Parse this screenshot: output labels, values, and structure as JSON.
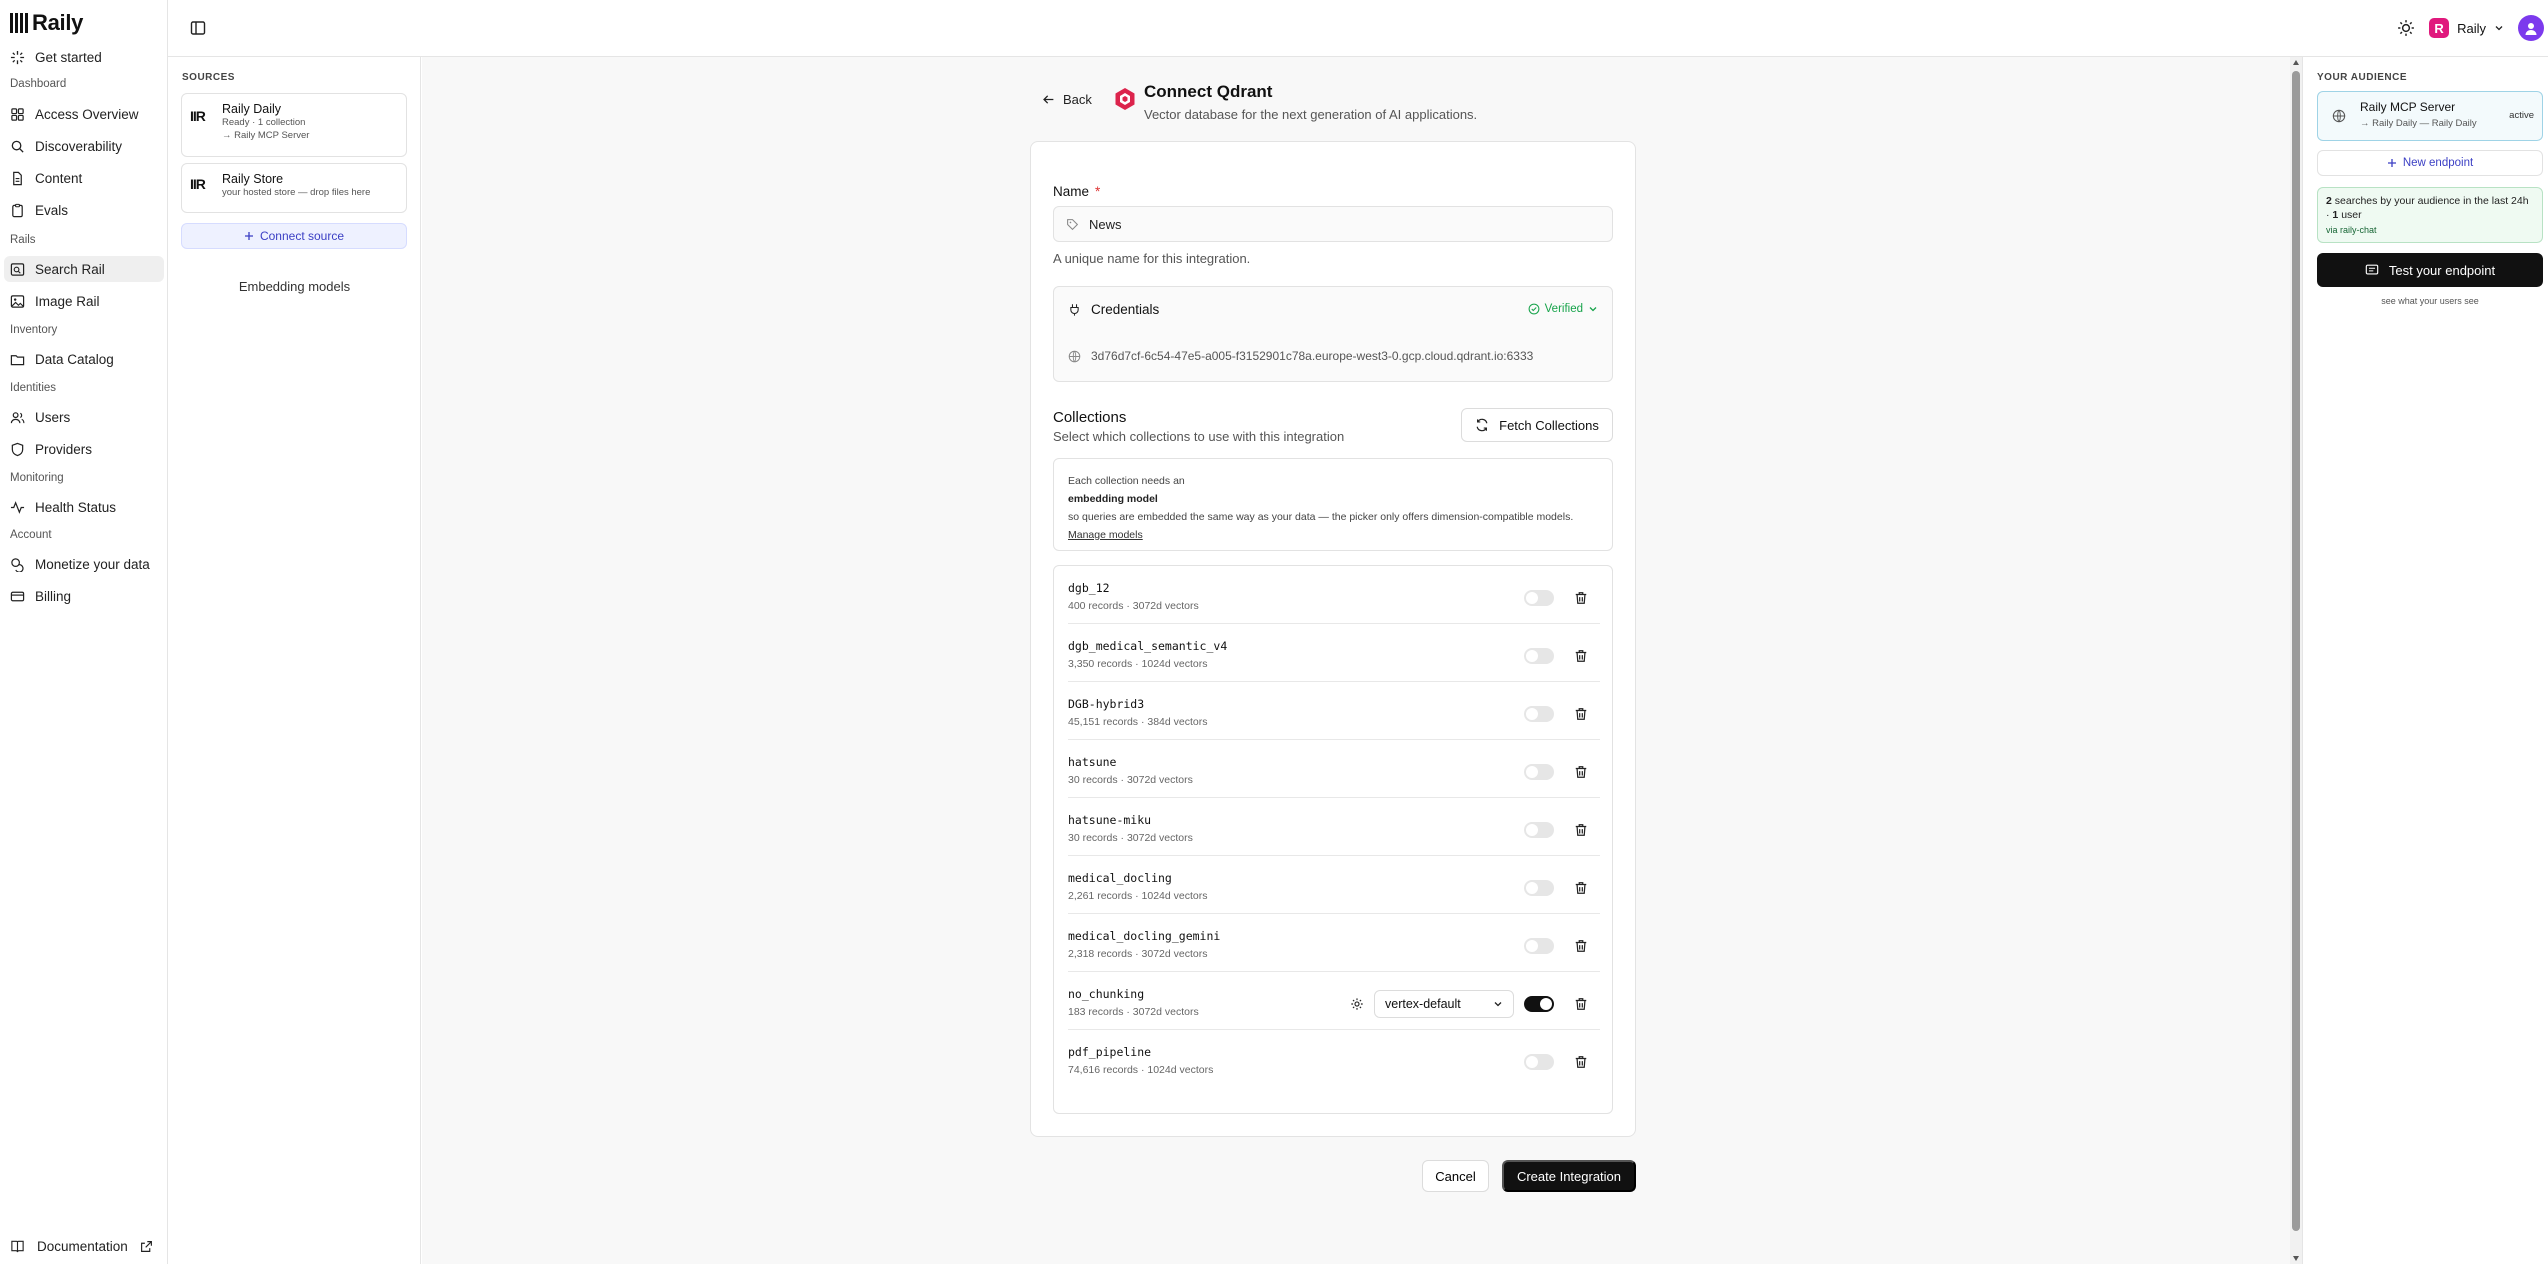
{
  "app": {
    "logo_text": "Raily"
  },
  "nav": {
    "get_started": "Get started",
    "sections": {
      "dashboard": "Dashboard",
      "rails": "Rails",
      "inventory": "Inventory",
      "identities": "Identities",
      "monitoring": "Monitoring",
      "account": "Account"
    },
    "items": {
      "access_overview": "Access Overview",
      "discoverability": "Discoverability",
      "content": "Content",
      "evals": "Evals",
      "search_rail": "Search Rail",
      "image_rail": "Image Rail",
      "data_catalog": "Data Catalog",
      "users": "Users",
      "providers": "Providers",
      "health_status": "Health Status",
      "monetize": "Monetize your data",
      "billing": "Billing"
    },
    "documentation": "Documentation"
  },
  "topbar": {
    "org_name": "Raily",
    "org_initial": "R"
  },
  "sources": {
    "title": "SOURCES",
    "cards": [
      {
        "logo": "IIR",
        "name": "Raily Daily",
        "line1": "Ready · 1 collection",
        "line2": "→ Raily MCP Server"
      },
      {
        "logo": "IIR",
        "name": "Raily Store",
        "line1": "your hosted store — drop files here",
        "line2": ""
      }
    ],
    "connect_label": "Connect source",
    "embedding_models": "Embedding models"
  },
  "main": {
    "back_label": "Back",
    "title": "Connect Qdrant",
    "subtitle": "Vector database for the next generation of AI applications.",
    "name_label": "Name",
    "required_mark": "*",
    "name_value": "News",
    "name_help": "A unique name for this integration.",
    "credentials_label": "Credentials",
    "verified_label": "Verified",
    "cred_url": "3d76d7cf-6c54-47e5-a005-f3152901c78a.europe-west3-0.gcp.cloud.qdrant.io:6333",
    "collections_title": "Collections",
    "collections_sub": "Select which collections to use with this integration",
    "fetch_label": "Fetch Collections",
    "info_line1": "Each collection needs an",
    "info_bold": "embedding model",
    "info_line2": "so queries are embedded the same way as your data — the picker only offers dimension-compatible models.",
    "info_link": "Manage models",
    "collections": [
      {
        "name": "dgb_12",
        "meta": "400 records · 3072d vectors",
        "enabled": false
      },
      {
        "name": "dgb_medical_semantic_v4",
        "meta": "3,350 records · 1024d vectors",
        "enabled": false
      },
      {
        "name": "DGB-hybrid3",
        "meta": "45,151 records · 384d vectors",
        "enabled": false
      },
      {
        "name": "hatsune",
        "meta": "30 records · 3072d vectors",
        "enabled": false
      },
      {
        "name": "hatsune-miku",
        "meta": "30 records · 3072d vectors",
        "enabled": false
      },
      {
        "name": "medical_docling",
        "meta": "2,261 records · 1024d vectors",
        "enabled": false
      },
      {
        "name": "medical_docling_gemini",
        "meta": "2,318 records · 3072d vectors",
        "enabled": false
      },
      {
        "name": "no_chunking",
        "meta": "183 records · 3072d vectors",
        "enabled": true,
        "model": "vertex-default"
      },
      {
        "name": "pdf_pipeline",
        "meta": "74,616 records · 1024d vectors",
        "enabled": false
      }
    ],
    "cancel_label": "Cancel",
    "create_label": "Create Integration"
  },
  "audience": {
    "title": "YOUR AUDIENCE",
    "endpoint_name": "Raily MCP Server",
    "endpoint_sub": "→ Raily Daily — Raily Daily",
    "endpoint_status": "active",
    "new_endpoint": "New endpoint",
    "searches_count": "2",
    "searches_text_a": "searches by your audience in the last 24h ·",
    "searches_users": "1",
    "searches_text_b": "user",
    "searches_via": "via raily-chat",
    "test_label": "Test your endpoint",
    "test_sub": "see what your users see"
  },
  "colors": {
    "accent": "#3b3fc4",
    "verified": "#16a34a",
    "brand": "#e0197d",
    "avatar": "#7c3aed",
    "primary_button": "#111111"
  }
}
